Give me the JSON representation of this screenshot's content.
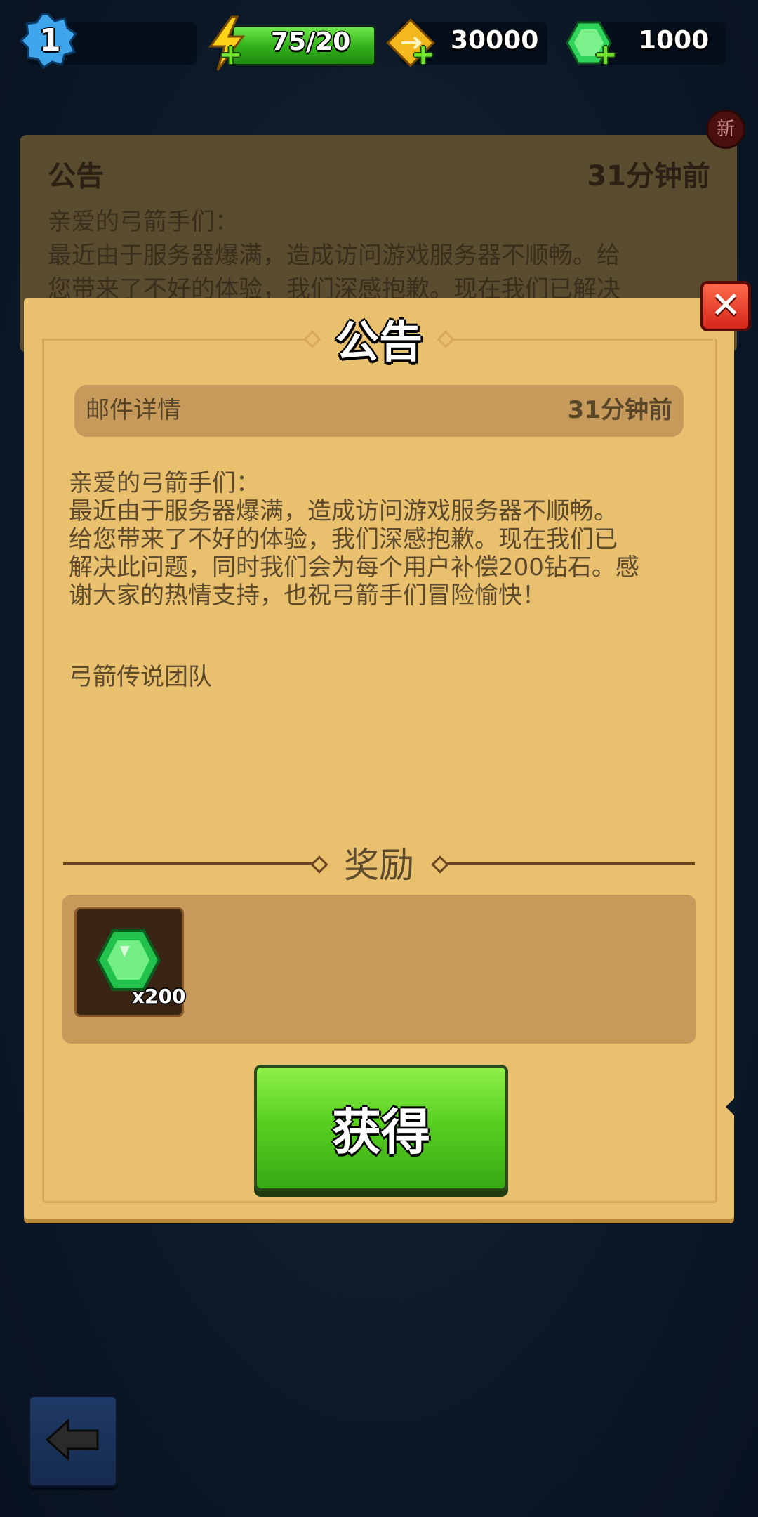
{
  "topbar": {
    "level": "1",
    "energy": "75/20",
    "gold": "30000",
    "gems": "1000"
  },
  "background_notice": {
    "badge": "新",
    "title": "公告",
    "time": "31分钟前",
    "line1": "亲爱的弓箭手们：",
    "line2": "最近由于服务器爆满，造成访问游戏服务器不顺畅。给",
    "line3": "您带来了不好的体验，我们深感抱歉。现在我们已解决"
  },
  "dialog": {
    "title": "公告",
    "header_label": "邮件详情",
    "header_time": "31分钟前",
    "body": [
      "亲爱的弓箭手们：",
      "最近由于服务器爆满，造成访问游戏服务器不顺畅。",
      "给您带来了不好的体验，我们深感抱歉。现在我们已",
      "解决此问题，同时我们会为每个用户补偿200钻石。感",
      "谢大家的热情支持，也祝弓箭手们冒险愉快！"
    ],
    "signature": "弓箭传说团队",
    "reward_title": "奖励",
    "reward_count": "x200",
    "claim_label": "获得"
  },
  "icons": [
    "level-badge-icon",
    "energy-icon",
    "gold-icon",
    "gem-icon",
    "plus-icon",
    "close-icon",
    "reward-gem-icon",
    "back-arrow-icon"
  ],
  "colors": {
    "panel": "#e8c06e",
    "accent_green": "#58d020",
    "background": "#0d1a2a"
  }
}
